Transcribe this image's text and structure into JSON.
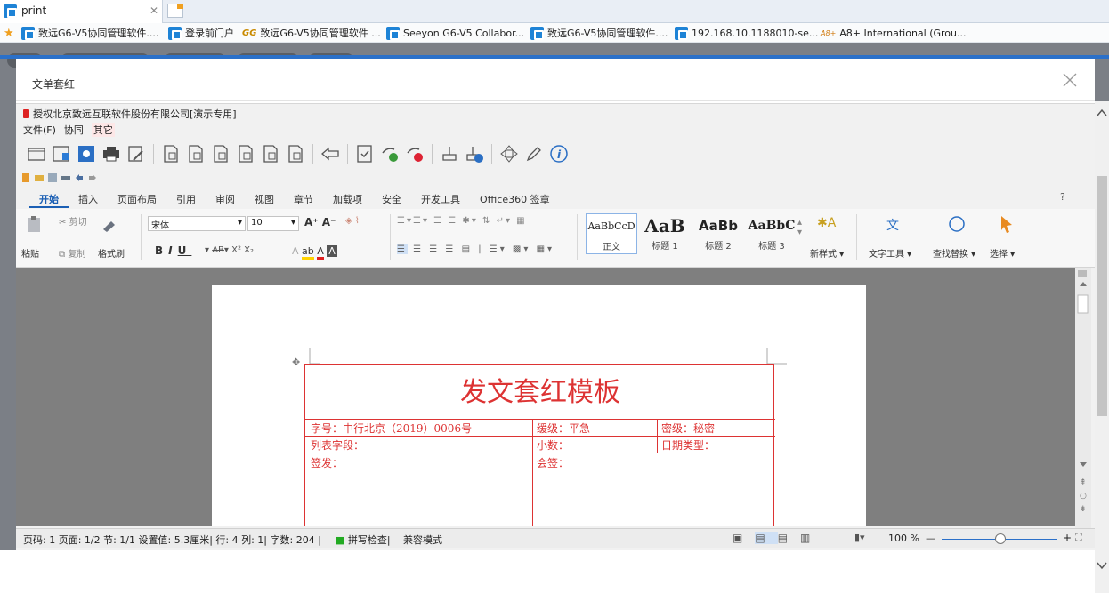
{
  "browser": {
    "tab_title": "print",
    "bookmarks": [
      "致远G6-V5协同管理软件....",
      "登录前门户",
      "致远G6-V5协同管理软件 ...",
      "Seeyon G6-V5 Collabor...",
      "致远G6-V5协同管理软件....",
      "192.168.10.1188010-se...",
      "A8+ International (Grou..."
    ],
    "bookmark_gg_prefix": "GG",
    "bookmark_a8_prefix": "A8+"
  },
  "modal": {
    "title": "文单套红"
  },
  "office": {
    "title": "授权北京致远互联软件股份有限公司[演示专用]",
    "menu": [
      "文件(F)",
      "协同",
      "其它"
    ],
    "ribbon_tabs": [
      "开始",
      "插入",
      "页面布局",
      "引用",
      "审阅",
      "视图",
      "章节",
      "加载项",
      "安全",
      "开发工具",
      "Office360 签章"
    ],
    "help": "?",
    "clipboard": {
      "paste": "粘贴",
      "cut": "剪切",
      "copy": "复制",
      "format_painter": "格式刷"
    },
    "font": {
      "name": "宋体",
      "size": "10"
    },
    "styles": [
      {
        "preview": "AaBbCcD",
        "name": "正文"
      },
      {
        "preview": "AaB",
        "name": "标题 1"
      },
      {
        "preview": "AaBb",
        "name": "标题 2"
      },
      {
        "preview": "AaBbC",
        "name": "标题 3"
      }
    ],
    "new_style": "新样式",
    "text_tools": "文字工具",
    "find_replace": "查找替换",
    "select": "选择"
  },
  "document": {
    "heading": "发文套红模板",
    "rows": [
      [
        "字号：中行北京（2019）0006号",
        "缓级：平急",
        "密级：秘密"
      ],
      [
        "列表字段：",
        "小数：",
        "日期类型："
      ],
      [
        "签发：",
        "会签：",
        ""
      ]
    ]
  },
  "status": {
    "text": "页码: 1  页面: 1/2  节: 1/1  设置值: 5.3厘米| 行: 4  列: 1|  字数: 204 |",
    "spell": "拼写检查|",
    "compat": "兼容模式",
    "zoom": "100 %"
  },
  "colors": {
    "accent": "#2b70c9",
    "red": "#d33333",
    "ribbon_active": "#1b5fb4"
  }
}
